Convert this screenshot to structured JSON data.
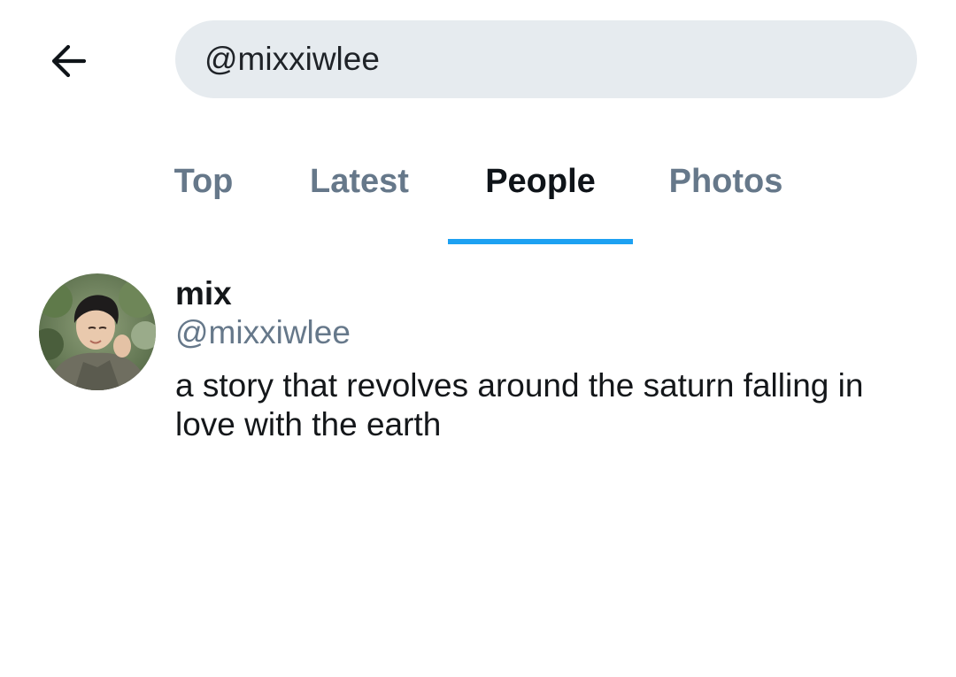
{
  "search": {
    "value": "@mixxiwlee",
    "back_icon": "arrow-left-icon"
  },
  "tabs": [
    {
      "label": "Top",
      "active": false
    },
    {
      "label": "Latest",
      "active": false
    },
    {
      "label": "People",
      "active": true
    },
    {
      "label": "Photos",
      "active": false
    }
  ],
  "results": [
    {
      "name": "mix",
      "handle": "@mixxiwlee",
      "bio": "a story that revolves around the saturn falling in love with the earth",
      "avatar": "profile-photo"
    }
  ],
  "colors": {
    "accent": "#1da1f2",
    "search_bg": "#e6ebef",
    "muted_text": "#66788a",
    "primary_text": "#14171a"
  }
}
